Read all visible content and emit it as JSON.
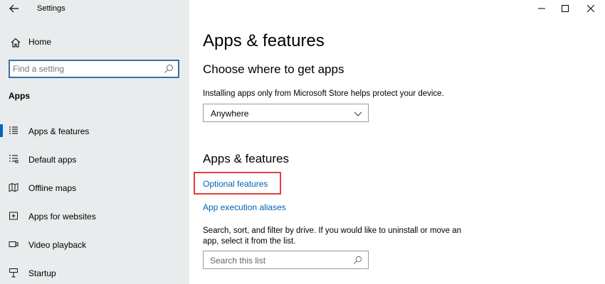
{
  "window": {
    "title": "Settings",
    "back_icon": "arrow-left-icon",
    "minimize_icon": "minimize-icon",
    "maximize_icon": "maximize-icon",
    "close_icon": "close-icon"
  },
  "sidebar": {
    "home_label": "Home",
    "search_placeholder": "Find a setting",
    "section_title": "Apps",
    "items": [
      {
        "label": "Apps & features",
        "icon": "list-icon",
        "selected": true
      },
      {
        "label": "Default apps",
        "icon": "default-apps-icon",
        "selected": false
      },
      {
        "label": "Offline maps",
        "icon": "map-icon",
        "selected": false
      },
      {
        "label": "Apps for websites",
        "icon": "web-apps-icon",
        "selected": false
      },
      {
        "label": "Video playback",
        "icon": "video-icon",
        "selected": false
      },
      {
        "label": "Startup",
        "icon": "startup-icon",
        "selected": false
      }
    ]
  },
  "main": {
    "page_title": "Apps & features",
    "choose_heading": "Choose where to get apps",
    "choose_desc": "Installing apps only from Microsoft Store helps protect your device.",
    "source_dropdown_value": "Anywhere",
    "features_heading": "Apps & features",
    "optional_features_link": "Optional features",
    "execution_aliases_link": "App execution aliases",
    "filter_desc_line1": "Search, sort, and filter by drive. If you would like to uninstall or move an",
    "filter_desc_line2": "app, select it from the list.",
    "list_search_placeholder": "Search this list"
  },
  "colors": {
    "sidebar_bg": "#e8ecec",
    "accent": "#0067c0",
    "link": "#0063b1",
    "highlight": "#e04040"
  }
}
